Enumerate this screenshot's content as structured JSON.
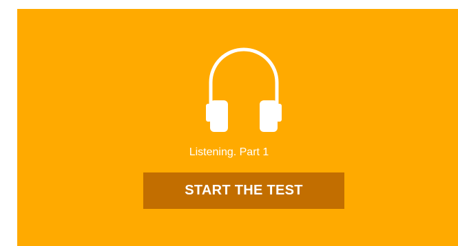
{
  "activity": {
    "icon": "headphones-icon",
    "title": "Listening. Part 1",
    "start_label": "START THE TEST"
  },
  "colors": {
    "card_background": "#FFAA00",
    "button_background": "#C26E00",
    "text": "#FFFFFF",
    "page_background": "#FFFFFF"
  }
}
